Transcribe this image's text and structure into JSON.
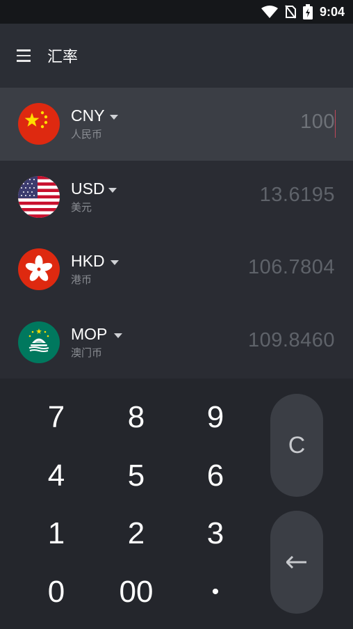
{
  "status": {
    "time": "9:04"
  },
  "app": {
    "title": "汇率"
  },
  "currencies": [
    {
      "code": "CNY",
      "name": "人民币",
      "amount": "100"
    },
    {
      "code": "USD",
      "name": "美元",
      "amount": "13.6195"
    },
    {
      "code": "HKD",
      "name": "港币",
      "amount": "106.7804"
    },
    {
      "code": "MOP",
      "name": "澳门币",
      "amount": "109.8460"
    }
  ],
  "keypad": {
    "keys": [
      "7",
      "8",
      "9",
      "4",
      "5",
      "6",
      "1",
      "2",
      "3",
      "0",
      "00",
      "•"
    ],
    "clear": "C"
  },
  "colors": {
    "background": "#24262c",
    "active_row": "#3b3e45",
    "cursor": "#c0475a"
  }
}
